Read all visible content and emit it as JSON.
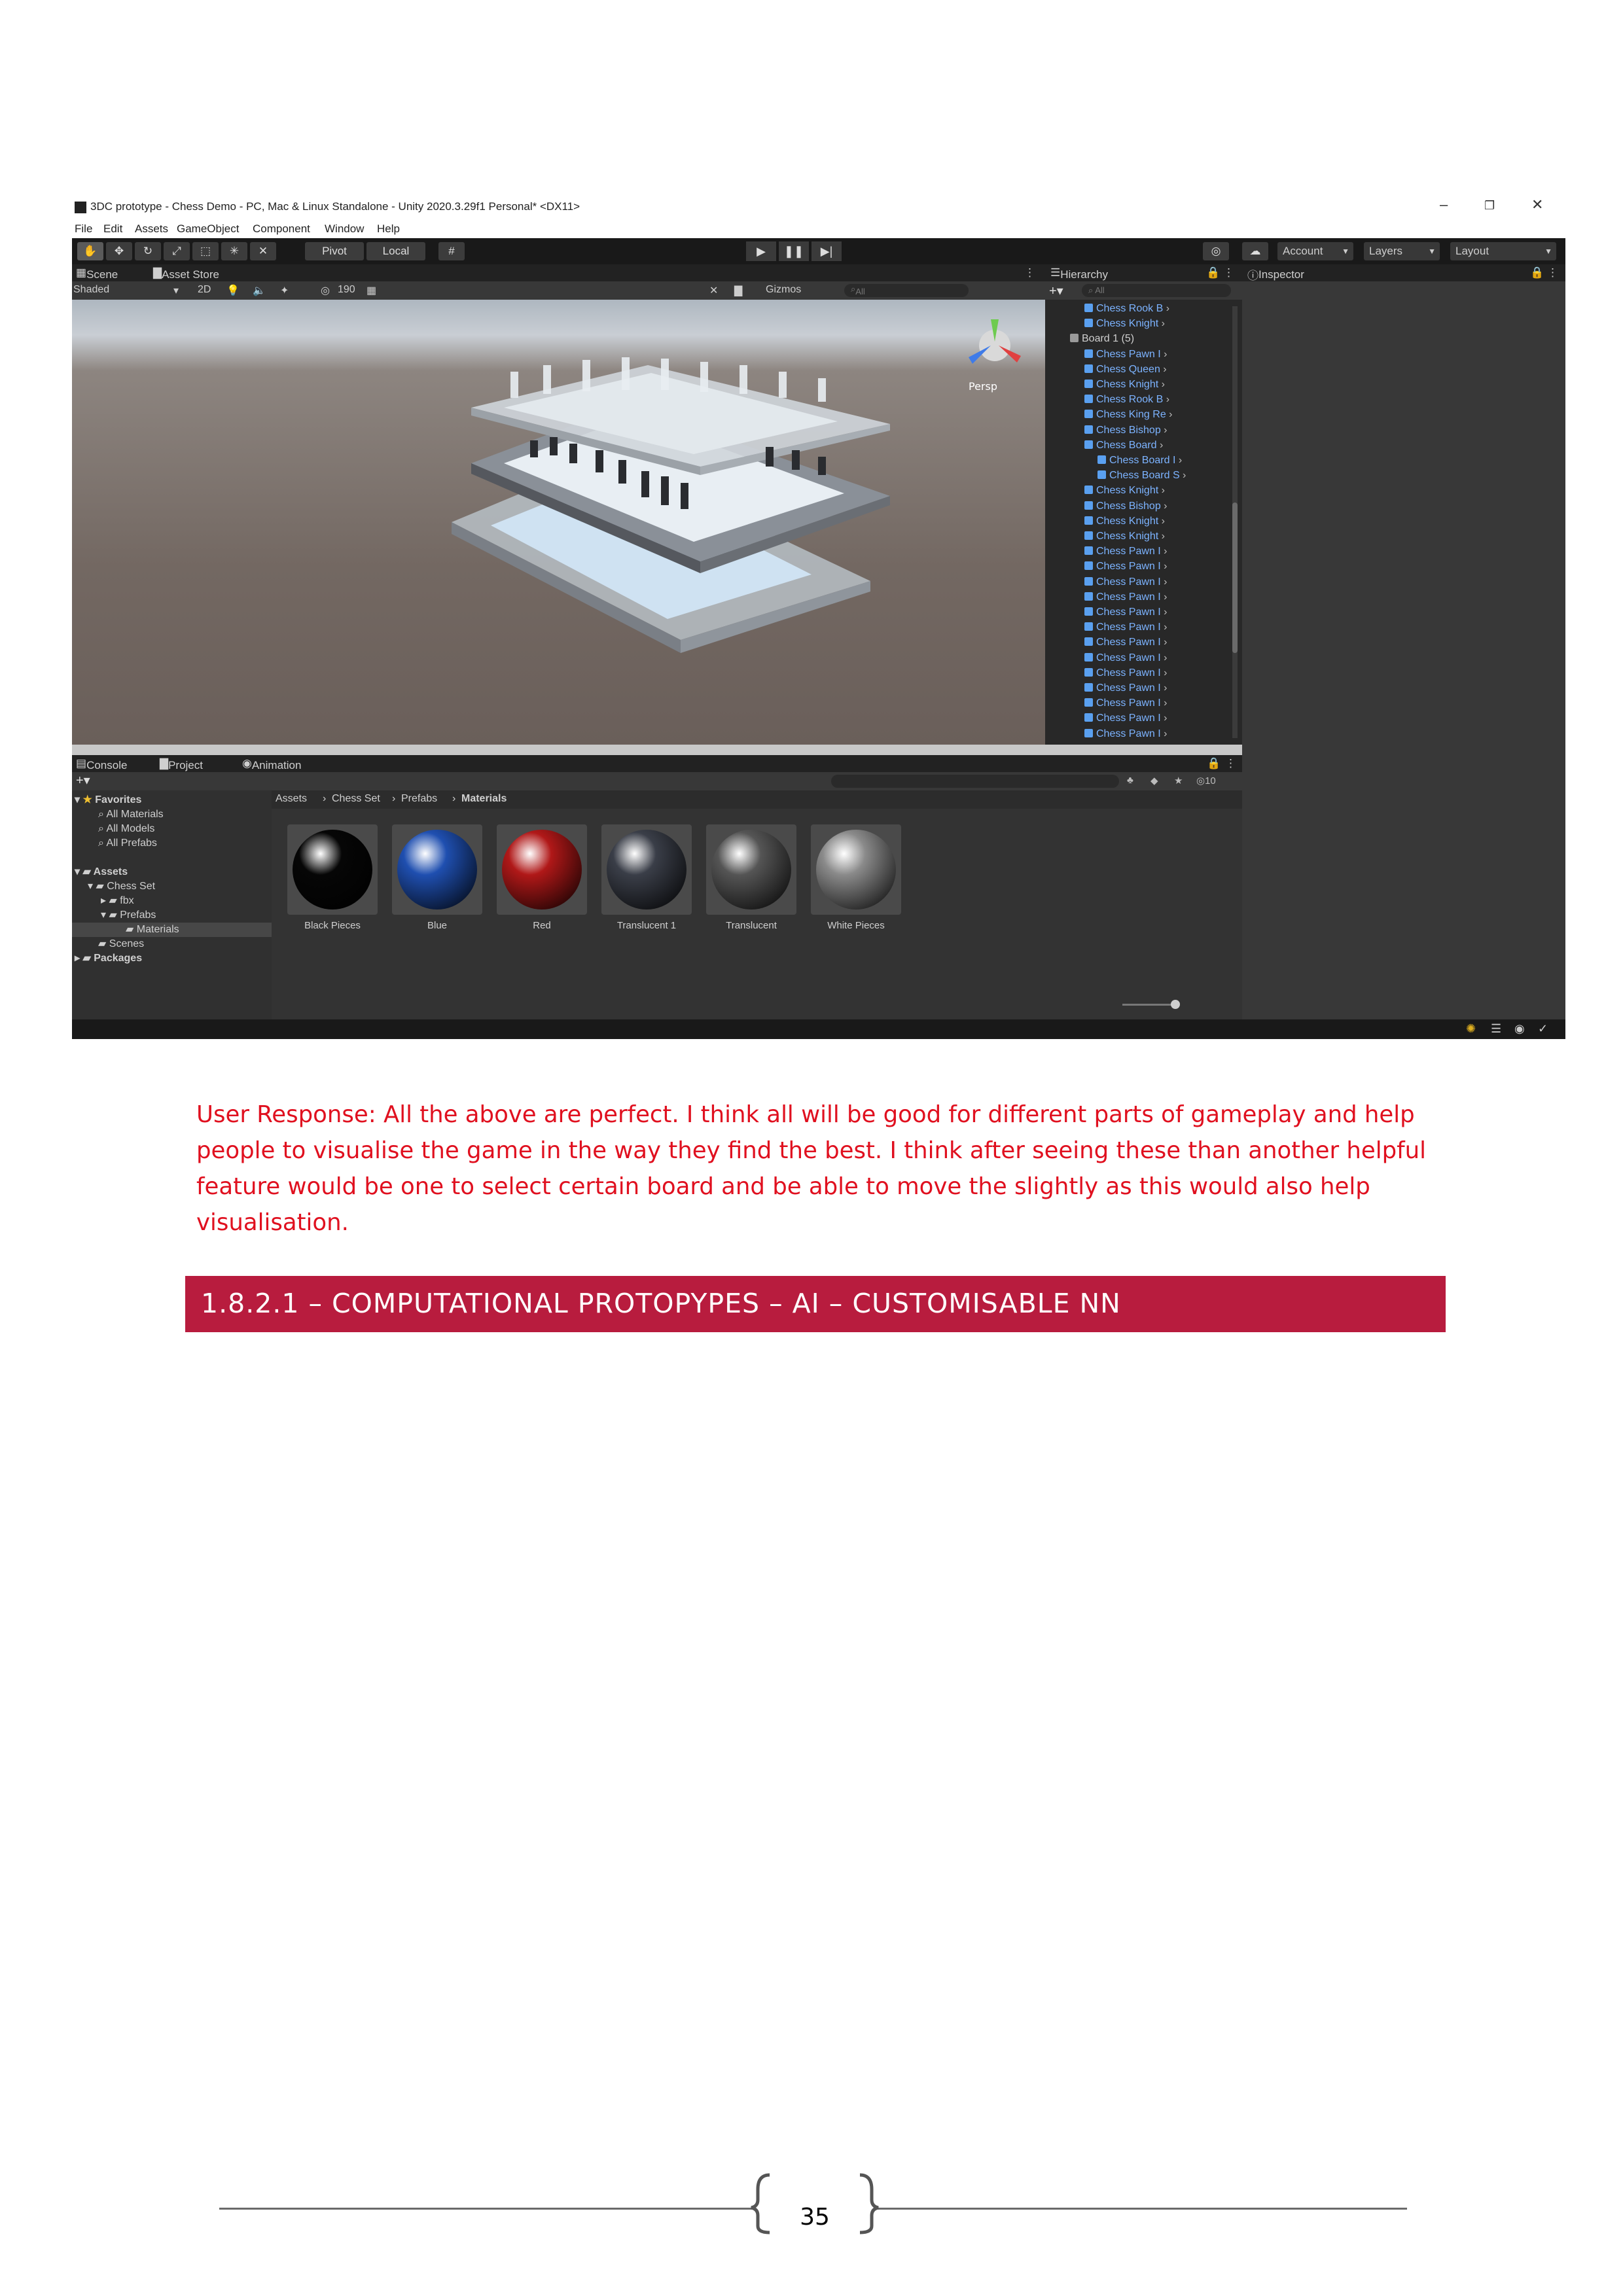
{
  "unity": {
    "window_title": "3DC prototype - Chess Demo - PC, Mac & Linux Standalone - Unity 2020.3.29f1 Personal* <DX11>",
    "menu": [
      "File",
      "Edit",
      "Assets",
      "GameObject",
      "Component",
      "Window",
      "Help"
    ],
    "toolbar": {
      "pivot_label": "Pivot",
      "local_label": "Local",
      "account_label": "Account",
      "layers_label": "Layers",
      "layout_label": "Layout"
    },
    "scene_tabs": {
      "scene": "Scene",
      "asset_store": "Asset Store"
    },
    "scene_bar": {
      "shading": "Shaded",
      "mode_2d": "2D",
      "hidden_count": "190",
      "gizmos": "Gizmos",
      "search_placeholder": "All"
    },
    "viewport": {
      "persp_label": "Persp"
    },
    "hierarchy": {
      "tab": "Hierarchy",
      "search_placeholder": "All",
      "items": [
        {
          "label": "Chess Rook B",
          "indent": 1,
          "plain": false
        },
        {
          "label": "Chess Knight",
          "indent": 1,
          "plain": false
        },
        {
          "label": "Board 1 (5)",
          "indent": 0,
          "plain": true
        },
        {
          "label": "Chess Pawn I",
          "indent": 1,
          "plain": false
        },
        {
          "label": "Chess Queen",
          "indent": 1,
          "plain": false
        },
        {
          "label": "Chess Knight",
          "indent": 1,
          "plain": false
        },
        {
          "label": "Chess Rook B",
          "indent": 1,
          "plain": false
        },
        {
          "label": "Chess King Re",
          "indent": 1,
          "plain": false
        },
        {
          "label": "Chess Bishop",
          "indent": 1,
          "plain": false
        },
        {
          "label": "Chess Board",
          "indent": 1,
          "plain": false
        },
        {
          "label": "Chess Board I",
          "indent": 2,
          "plain": false
        },
        {
          "label": "Chess Board S",
          "indent": 2,
          "plain": false
        },
        {
          "label": "Chess Knight",
          "indent": 1,
          "plain": false
        },
        {
          "label": "Chess Bishop",
          "indent": 1,
          "plain": false
        },
        {
          "label": "Chess Knight",
          "indent": 1,
          "plain": false
        },
        {
          "label": "Chess Knight",
          "indent": 1,
          "plain": false
        },
        {
          "label": "Chess Pawn I",
          "indent": 1,
          "plain": false
        },
        {
          "label": "Chess Pawn I",
          "indent": 1,
          "plain": false
        },
        {
          "label": "Chess Pawn I",
          "indent": 1,
          "plain": false
        },
        {
          "label": "Chess Pawn I",
          "indent": 1,
          "plain": false
        },
        {
          "label": "Chess Pawn I",
          "indent": 1,
          "plain": false
        },
        {
          "label": "Chess Pawn I",
          "indent": 1,
          "plain": false
        },
        {
          "label": "Chess Pawn I",
          "indent": 1,
          "plain": false
        },
        {
          "label": "Chess Pawn I",
          "indent": 1,
          "plain": false
        },
        {
          "label": "Chess Pawn I",
          "indent": 1,
          "plain": false
        },
        {
          "label": "Chess Pawn I",
          "indent": 1,
          "plain": false
        },
        {
          "label": "Chess Pawn I",
          "indent": 1,
          "plain": false
        },
        {
          "label": "Chess Pawn I",
          "indent": 1,
          "plain": false
        },
        {
          "label": "Chess Pawn I",
          "indent": 1,
          "plain": false
        }
      ]
    },
    "inspector": {
      "tab": "Inspector"
    },
    "bottom_tabs": {
      "console": "Console",
      "project": "Project",
      "animation": "Animation"
    },
    "project": {
      "hidden_count": "10",
      "tree": {
        "favorites": "Favorites",
        "all_materials": "All Materials",
        "all_models": "All Models",
        "all_prefabs": "All Prefabs",
        "assets": "Assets",
        "chess_set": "Chess Set",
        "fbx": "fbx",
        "prefabs": "Prefabs",
        "materials": "Materials",
        "scenes": "Scenes",
        "packages": "Packages"
      },
      "breadcrumb": [
        "Assets",
        "Chess Set",
        "Prefabs",
        "Materials"
      ],
      "materials": [
        {
          "label": "Black Pieces",
          "color": "#060606"
        },
        {
          "label": "Blue",
          "color": "#1f4fb0"
        },
        {
          "label": "Red",
          "color": "#b01818"
        },
        {
          "label": "Translucent 1",
          "color": "#3a3e48"
        },
        {
          "label": "Translucent",
          "color": "#555555"
        },
        {
          "label": "White Pieces",
          "color": "#8a8a8a"
        }
      ]
    }
  },
  "document": {
    "response": "User Response: All the above are perfect. I think all will be good for different parts of gameplay and help people to visualise the game in the way they find the best. I think after seeing these than another helpful feature would be one to select certain board and be able to move the slightly as this would also help visualisation.",
    "heading": "1.8.2.1 – COMPUTATIONAL PROTOPYPES – AI – CUSTOMISABLE NN",
    "page_number": "35",
    "colors": {
      "response_text": "#e0101f",
      "heading_bar": "#b81c3e"
    }
  }
}
